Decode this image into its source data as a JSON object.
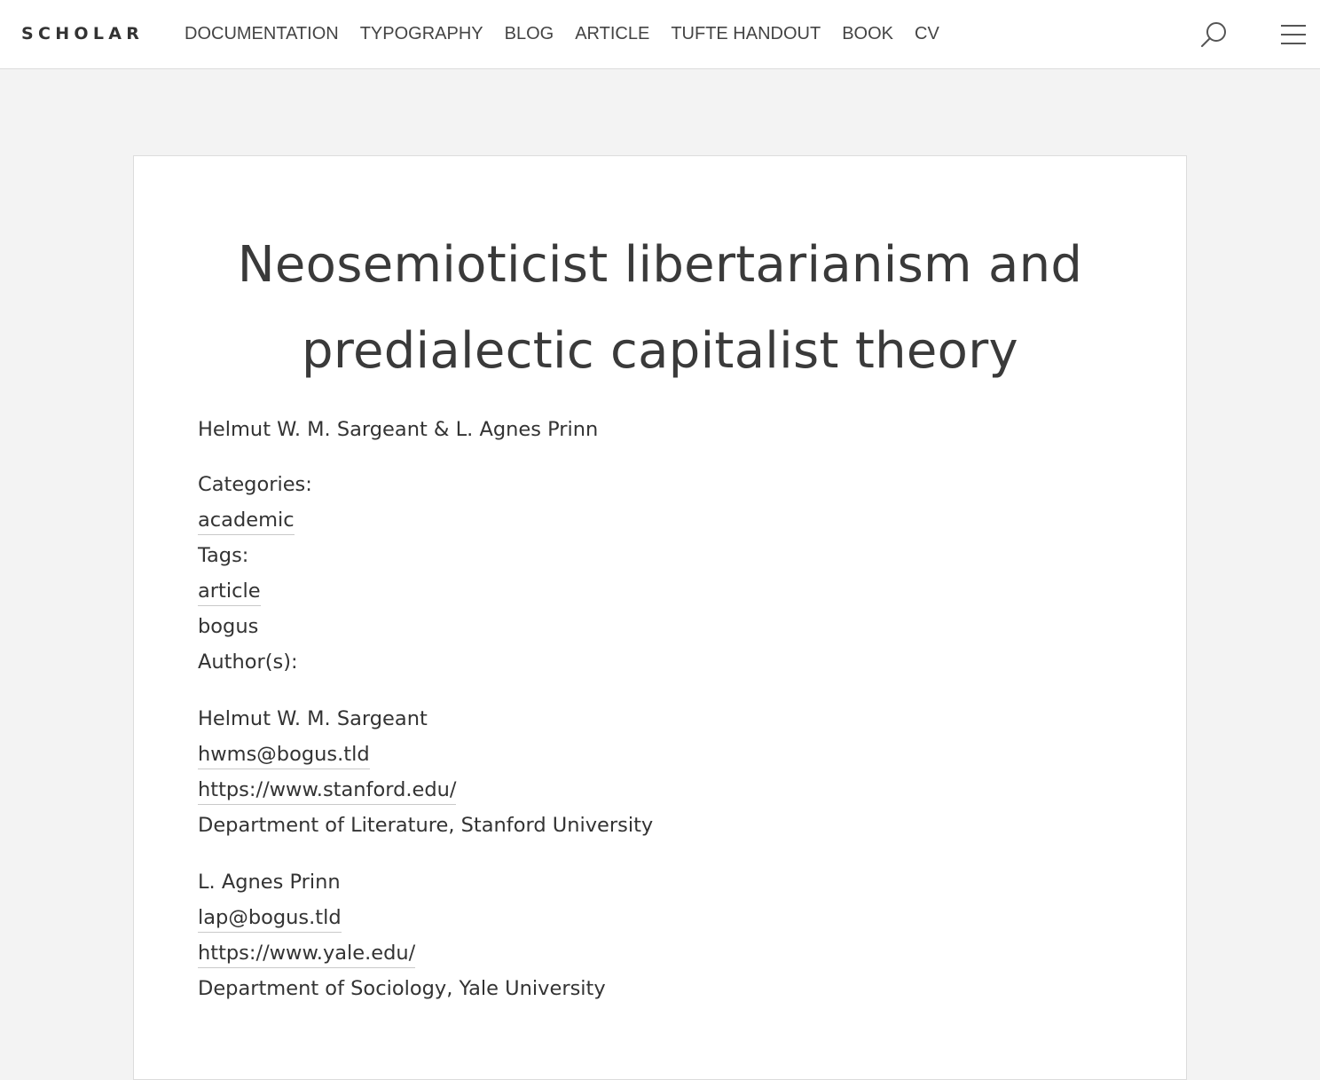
{
  "header": {
    "brand": "SCHOLAR",
    "nav": [
      "DOCUMENTATION",
      "TYPOGRAPHY",
      "BLOG",
      "ARTICLE",
      "TUFTE HANDOUT",
      "BOOK",
      "CV"
    ],
    "icons": {
      "search": "search-icon",
      "menu": "hamburger-menu-icon"
    }
  },
  "article": {
    "title_line1": "Neosemioticist libertarianism and",
    "title_line2": "predialectic capitalist theory",
    "byline": "Helmut W. M. Sargeant & L. Agnes Prinn",
    "categories_label": "Categories:",
    "categories": [
      "academic"
    ],
    "tags_label": "Tags:",
    "tags": [
      "article",
      "bogus"
    ],
    "authors_label": "Author(s):",
    "authors": [
      {
        "name": "Helmut W. M. Sargeant",
        "email": "hwms@bogus.tld",
        "url": "https://www.stanford.edu/",
        "affiliation": "Department of Literature, Stanford University"
      },
      {
        "name": "L. Agnes Prinn",
        "email": "lap@bogus.tld",
        "url": "https://www.yale.edu/",
        "affiliation": "Department of Sociology, Yale University"
      }
    ]
  },
  "colors": {
    "page_bg": "#f3f3f3",
    "card_bg": "#ffffff",
    "text": "#333333",
    "border": "#dcdcdc"
  }
}
